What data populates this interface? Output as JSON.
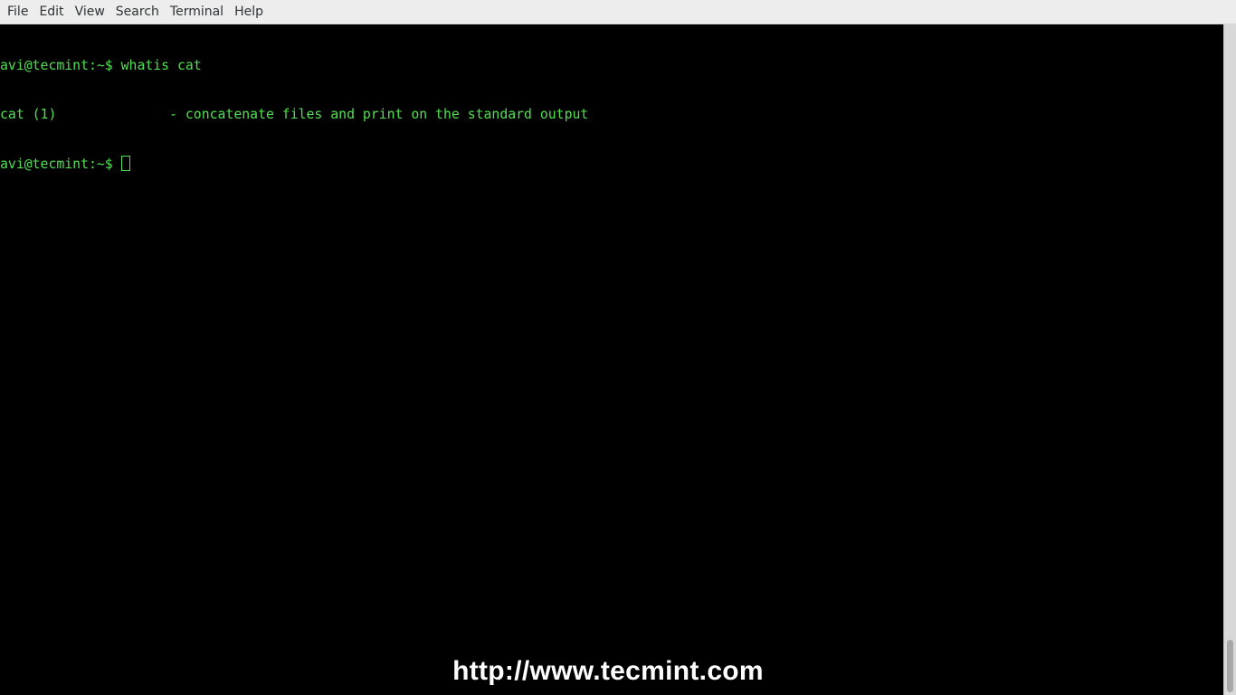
{
  "menubar": {
    "items": [
      "File",
      "Edit",
      "View",
      "Search",
      "Terminal",
      "Help"
    ]
  },
  "terminal": {
    "lines": [
      "avi@tecmint:~$ whatis cat",
      "cat (1)              - concatenate files and print on the standard output"
    ],
    "prompt": "avi@tecmint:~$ ",
    "text_color": "#4fe04f",
    "background_color": "#000000"
  },
  "scrollbar": {
    "position": "bottom"
  },
  "watermark": {
    "text": "http://www.tecmint.com"
  }
}
